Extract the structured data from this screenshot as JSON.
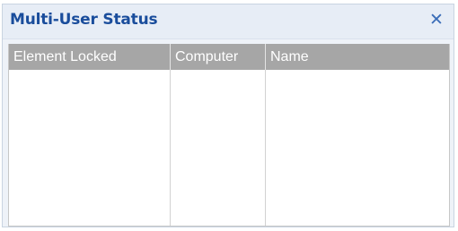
{
  "panel": {
    "title": "Multi-User Status",
    "close_glyph": "✕"
  },
  "table": {
    "columns": [
      "Element Locked",
      "Computer",
      "Name"
    ],
    "rows": []
  },
  "colors": {
    "title_text": "#1a4d9c",
    "header_bg": "#a6a6a6",
    "panel_bg": "#eef2f8"
  }
}
